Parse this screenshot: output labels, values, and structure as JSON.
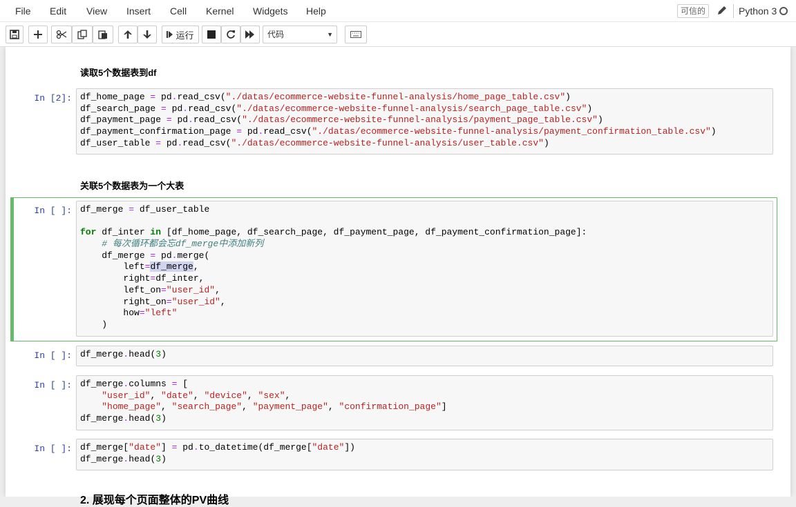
{
  "menubar": {
    "items": [
      "File",
      "Edit",
      "View",
      "Insert",
      "Cell",
      "Kernel",
      "Widgets",
      "Help"
    ],
    "trusted_label": "可信的",
    "kernel_name": "Python 3"
  },
  "toolbar": {
    "buttons": [
      "save-icon",
      "plus-icon",
      "cut-icon",
      "copy-icon",
      "paste-icon",
      "arrow-up-icon",
      "arrow-down-icon",
      "run-button",
      "stop-icon",
      "restart-icon",
      "fast-forward-icon",
      "keyboard-icon"
    ],
    "run_label": "运行",
    "cell_type_value": "代码"
  },
  "cells": {
    "md1": "读取5个数据表到df",
    "prompt1": "In [2]:",
    "md2": "关联5个数据表为一个大表",
    "prompt2": "In [ ]:",
    "prompt3": "In [ ]:",
    "prompt4": "In [ ]:",
    "prompt5": "In [ ]:",
    "code1": [
      "df_home_page = pd.read_csv(\"./datas/ecommerce-website-funnel-analysis/home_page_table.csv\")",
      "df_search_page = pd.read_csv(\"./datas/ecommerce-website-funnel-analysis/search_page_table.csv\")",
      "df_payment_page = pd.read_csv(\"./datas/ecommerce-website-funnel-analysis/payment_page_table.csv\")",
      "df_payment_confirmation_page = pd.read_csv(\"./datas/ecommerce-website-funnel-analysis/payment_confirmation_table.csv\")",
      "df_user_table = pd.read_csv(\"./datas/ecommerce-website-funnel-analysis/user_table.csv\")"
    ],
    "code2": [
      "df_merge = df_user_table",
      "",
      "for df_inter in [df_home_page, df_search_page, df_payment_page, df_payment_confirmation_page]:",
      "    # 每次循环都会忘df_merge中添加新列",
      "    df_merge = pd.merge(",
      "        left=df_merge,",
      "        right=df_inter,",
      "        left_on=\"user_id\",",
      "        right_on=\"user_id\",",
      "        how=\"left\"",
      "    )"
    ],
    "code3": [
      "df_merge.head(3)"
    ],
    "code4": [
      "df_merge.columns = [",
      "    \"user_id\", \"date\", \"device\", \"sex\",",
      "    \"home_page\", \"search_page\", \"payment_page\", \"confirmation_page\"]",
      "df_merge.head(3)"
    ],
    "code5": [
      "df_merge[\"date\"] = pd.to_datetime(df_merge[\"date\"])",
      "df_merge.head(3)"
    ],
    "next_heading_partial": "2. 展现每个页面整体的PV曲线"
  },
  "colors": {
    "selected_border": "#66bb6a",
    "prompt": "#303f9f",
    "string": "#ba2121",
    "operator": "#aa22ff",
    "keyword": "#008000",
    "comment": "#408080"
  }
}
